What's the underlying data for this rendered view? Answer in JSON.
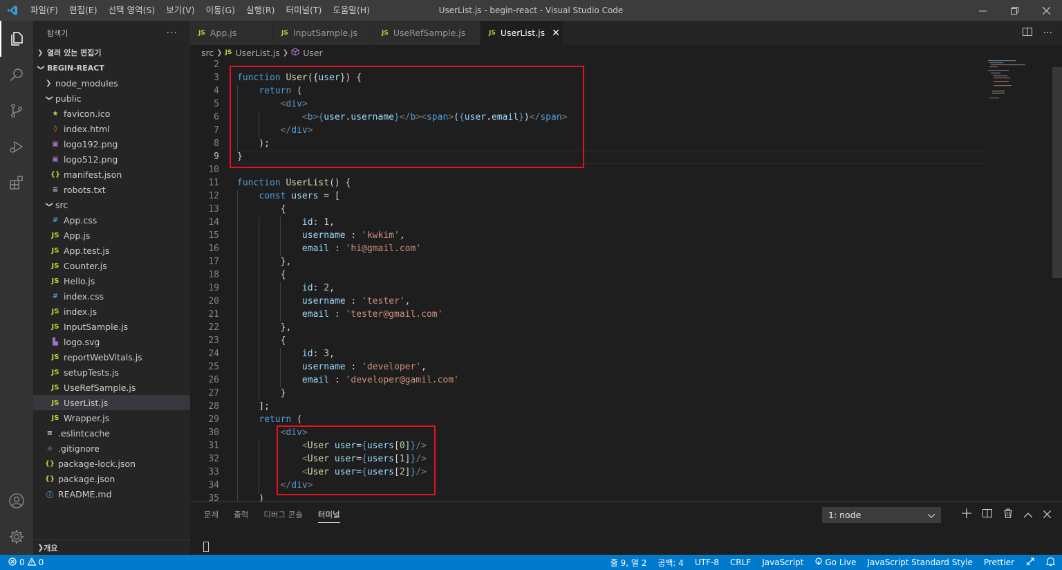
{
  "window": {
    "title": "UserList.js - begin-react - Visual Studio Code",
    "menu": [
      "파일(F)",
      "편집(E)",
      "선택 영역(S)",
      "보기(V)",
      "이동(G)",
      "실행(R)",
      "터미널(T)",
      "도움말(H)"
    ]
  },
  "sidebar": {
    "title": "탐색기",
    "open_editors": "열려 있는 편집기",
    "project": "BEGIN-REACT",
    "outline": "개요",
    "items": [
      {
        "label": "node_modules",
        "type": "folder",
        "open": false,
        "depth": 1
      },
      {
        "label": "public",
        "type": "folder",
        "open": true,
        "depth": 1
      },
      {
        "label": "favicon.ico",
        "type": "ico",
        "depth": 2
      },
      {
        "label": "index.html",
        "type": "html",
        "depth": 2
      },
      {
        "label": "logo192.png",
        "type": "img",
        "depth": 2
      },
      {
        "label": "logo512.png",
        "type": "img",
        "depth": 2
      },
      {
        "label": "manifest.json",
        "type": "json",
        "depth": 2
      },
      {
        "label": "robots.txt",
        "type": "txt",
        "depth": 2
      },
      {
        "label": "src",
        "type": "folder",
        "open": true,
        "depth": 1
      },
      {
        "label": "App.css",
        "type": "css",
        "depth": 2
      },
      {
        "label": "App.js",
        "type": "js",
        "depth": 2
      },
      {
        "label": "App.test.js",
        "type": "js",
        "depth": 2
      },
      {
        "label": "Counter.js",
        "type": "js",
        "depth": 2
      },
      {
        "label": "Hello.js",
        "type": "js",
        "depth": 2
      },
      {
        "label": "index.css",
        "type": "css",
        "depth": 2
      },
      {
        "label": "index.js",
        "type": "js",
        "depth": 2
      },
      {
        "label": "InputSample.js",
        "type": "js",
        "depth": 2
      },
      {
        "label": "logo.svg",
        "type": "svg",
        "depth": 2
      },
      {
        "label": "reportWebVitals.js",
        "type": "js",
        "depth": 2
      },
      {
        "label": "setupTests.js",
        "type": "js",
        "depth": 2
      },
      {
        "label": "UseRefSample.js",
        "type": "js",
        "depth": 2
      },
      {
        "label": "UserList.js",
        "type": "js",
        "depth": 2,
        "selected": true
      },
      {
        "label": "Wrapper.js",
        "type": "js",
        "depth": 2
      },
      {
        "label": ".eslintcache",
        "type": "txt",
        "depth": 1
      },
      {
        "label": ".gitignore",
        "type": "git",
        "depth": 1
      },
      {
        "label": "package-lock.json",
        "type": "json",
        "depth": 1
      },
      {
        "label": "package.json",
        "type": "json",
        "depth": 1
      },
      {
        "label": "README.md",
        "type": "info",
        "depth": 1
      }
    ]
  },
  "tabs": [
    {
      "label": "App.js",
      "active": false
    },
    {
      "label": "InputSample.js",
      "active": false
    },
    {
      "label": "UseRefSample.js",
      "active": false
    },
    {
      "label": "UserList.js",
      "active": true
    }
  ],
  "breadcrumb": {
    "folder": "src",
    "file": "UserList.js",
    "symbol": "User"
  },
  "editor": {
    "current_line": 9,
    "lines": [
      {
        "n": 2,
        "t": []
      },
      {
        "n": 3,
        "t": [
          [
            "kw",
            "function "
          ],
          [
            "fn",
            "User"
          ],
          [
            "plain",
            "({"
          ],
          [
            "var",
            "user"
          ],
          [
            "plain",
            "}) {"
          ]
        ]
      },
      {
        "n": 4,
        "t": [
          [
            "plain",
            "    "
          ],
          [
            "kw",
            "return"
          ],
          [
            "plain",
            " ("
          ]
        ]
      },
      {
        "n": 5,
        "t": [
          [
            "plain",
            "        "
          ],
          [
            "pun",
            "<"
          ],
          [
            "tag",
            "div"
          ],
          [
            "pun",
            ">"
          ]
        ]
      },
      {
        "n": 6,
        "t": [
          [
            "plain",
            "            "
          ],
          [
            "pun",
            "<"
          ],
          [
            "tag",
            "b"
          ],
          [
            "pun",
            ">"
          ],
          [
            "kw",
            "{"
          ],
          [
            "var",
            "user"
          ],
          [
            "plain",
            "."
          ],
          [
            "var",
            "username"
          ],
          [
            "kw",
            "}"
          ],
          [
            "pun",
            "</"
          ],
          [
            "tag",
            "b"
          ],
          [
            "pun",
            "><"
          ],
          [
            "tag",
            "span"
          ],
          [
            "pun",
            ">"
          ],
          [
            "plain",
            "("
          ],
          [
            "kw",
            "{"
          ],
          [
            "var",
            "user"
          ],
          [
            "plain",
            "."
          ],
          [
            "var",
            "email"
          ],
          [
            "kw",
            "}"
          ],
          [
            "plain",
            ")"
          ],
          [
            "pun",
            "</"
          ],
          [
            "tag",
            "span"
          ],
          [
            "pun",
            ">"
          ]
        ]
      },
      {
        "n": 7,
        "t": [
          [
            "plain",
            "        "
          ],
          [
            "pun",
            "</"
          ],
          [
            "tag",
            "div"
          ],
          [
            "pun",
            ">"
          ]
        ]
      },
      {
        "n": 8,
        "t": [
          [
            "plain",
            "    );"
          ]
        ]
      },
      {
        "n": 9,
        "t": [
          [
            "plain",
            "}"
          ]
        ]
      },
      {
        "n": 10,
        "t": []
      },
      {
        "n": 11,
        "t": [
          [
            "kw",
            "function "
          ],
          [
            "fn",
            "UserList"
          ],
          [
            "plain",
            "() {"
          ]
        ]
      },
      {
        "n": 12,
        "t": [
          [
            "plain",
            "    "
          ],
          [
            "kw",
            "const "
          ],
          [
            "var",
            "users"
          ],
          [
            "plain",
            " = ["
          ]
        ]
      },
      {
        "n": 13,
        "t": [
          [
            "plain",
            "        {"
          ]
        ]
      },
      {
        "n": 14,
        "t": [
          [
            "plain",
            "            "
          ],
          [
            "var",
            "id"
          ],
          [
            "plain",
            ": "
          ],
          [
            "num",
            "1"
          ],
          [
            "plain",
            ","
          ]
        ]
      },
      {
        "n": 15,
        "t": [
          [
            "plain",
            "            "
          ],
          [
            "var",
            "username"
          ],
          [
            "plain",
            " : "
          ],
          [
            "str",
            "'kwkim'"
          ],
          [
            "plain",
            ","
          ]
        ]
      },
      {
        "n": 16,
        "t": [
          [
            "plain",
            "            "
          ],
          [
            "var",
            "email"
          ],
          [
            "plain",
            " : "
          ],
          [
            "str",
            "'hi@gmail.com'"
          ]
        ]
      },
      {
        "n": 17,
        "t": [
          [
            "plain",
            "        },"
          ]
        ]
      },
      {
        "n": 18,
        "t": [
          [
            "plain",
            "        {"
          ]
        ]
      },
      {
        "n": 19,
        "t": [
          [
            "plain",
            "            "
          ],
          [
            "var",
            "id"
          ],
          [
            "plain",
            ": "
          ],
          [
            "num",
            "2"
          ],
          [
            "plain",
            ","
          ]
        ]
      },
      {
        "n": 20,
        "t": [
          [
            "plain",
            "            "
          ],
          [
            "var",
            "username"
          ],
          [
            "plain",
            " : "
          ],
          [
            "str",
            "'tester'"
          ],
          [
            "plain",
            ","
          ]
        ]
      },
      {
        "n": 21,
        "t": [
          [
            "plain",
            "            "
          ],
          [
            "var",
            "email"
          ],
          [
            "plain",
            " : "
          ],
          [
            "str",
            "'tester@gmail.com'"
          ]
        ]
      },
      {
        "n": 22,
        "t": [
          [
            "plain",
            "        },"
          ]
        ]
      },
      {
        "n": 23,
        "t": [
          [
            "plain",
            "        {"
          ]
        ]
      },
      {
        "n": 24,
        "t": [
          [
            "plain",
            "            "
          ],
          [
            "var",
            "id"
          ],
          [
            "plain",
            ": "
          ],
          [
            "num",
            "3"
          ],
          [
            "plain",
            ","
          ]
        ]
      },
      {
        "n": 25,
        "t": [
          [
            "plain",
            "            "
          ],
          [
            "var",
            "username"
          ],
          [
            "plain",
            " : "
          ],
          [
            "str",
            "'developer'"
          ],
          [
            "plain",
            ","
          ]
        ]
      },
      {
        "n": 26,
        "t": [
          [
            "plain",
            "            "
          ],
          [
            "var",
            "email"
          ],
          [
            "plain",
            " : "
          ],
          [
            "str",
            "'developer@gamil.com'"
          ]
        ]
      },
      {
        "n": 27,
        "t": [
          [
            "plain",
            "        }"
          ]
        ]
      },
      {
        "n": 28,
        "t": [
          [
            "plain",
            "    ];"
          ]
        ]
      },
      {
        "n": 29,
        "t": [
          [
            "plain",
            "    "
          ],
          [
            "kw",
            "return"
          ],
          [
            "plain",
            " ("
          ]
        ]
      },
      {
        "n": 30,
        "t": [
          [
            "plain",
            "        "
          ],
          [
            "pun",
            "<"
          ],
          [
            "tag",
            "div"
          ],
          [
            "pun",
            ">"
          ]
        ]
      },
      {
        "n": 31,
        "t": [
          [
            "plain",
            "            "
          ],
          [
            "pun",
            "<"
          ],
          [
            "fn",
            "User"
          ],
          [
            "plain",
            " "
          ],
          [
            "var",
            "user"
          ],
          [
            "plain",
            "="
          ],
          [
            "kw",
            "{"
          ],
          [
            "var",
            "users"
          ],
          [
            "plain",
            "["
          ],
          [
            "num",
            "0"
          ],
          [
            "plain",
            "]"
          ],
          [
            "kw",
            "}"
          ],
          [
            "pun",
            "/>"
          ]
        ]
      },
      {
        "n": 32,
        "t": [
          [
            "plain",
            "            "
          ],
          [
            "pun",
            "<"
          ],
          [
            "fn",
            "User"
          ],
          [
            "plain",
            " "
          ],
          [
            "var",
            "user"
          ],
          [
            "plain",
            "="
          ],
          [
            "kw",
            "{"
          ],
          [
            "var",
            "users"
          ],
          [
            "plain",
            "["
          ],
          [
            "num",
            "1"
          ],
          [
            "plain",
            "]"
          ],
          [
            "kw",
            "}"
          ],
          [
            "pun",
            "/>"
          ]
        ]
      },
      {
        "n": 33,
        "t": [
          [
            "plain",
            "            "
          ],
          [
            "pun",
            "<"
          ],
          [
            "fn",
            "User"
          ],
          [
            "plain",
            " "
          ],
          [
            "var",
            "user"
          ],
          [
            "plain",
            "="
          ],
          [
            "kw",
            "{"
          ],
          [
            "var",
            "users"
          ],
          [
            "plain",
            "["
          ],
          [
            "num",
            "2"
          ],
          [
            "plain",
            "]"
          ],
          [
            "kw",
            "}"
          ],
          [
            "pun",
            "/>"
          ]
        ]
      },
      {
        "n": 34,
        "t": [
          [
            "plain",
            "        "
          ],
          [
            "pun",
            "</"
          ],
          [
            "tag",
            "div"
          ],
          [
            "pun",
            ">"
          ]
        ]
      },
      {
        "n": 35,
        "t": [
          [
            "plain",
            "    )"
          ]
        ]
      }
    ]
  },
  "panel": {
    "tabs": [
      "문제",
      "출력",
      "디버그 콘솔",
      "터미널"
    ],
    "active_tab": "터미널",
    "terminal_select": "1: node"
  },
  "statusbar": {
    "errors": "0",
    "warnings": "0",
    "position": "줄 9, 열 2",
    "spaces": "공백: 4",
    "encoding": "UTF-8",
    "eol": "CRLF",
    "language": "JavaScript",
    "golive": "Go Live",
    "style": "JavaScript Standard Style",
    "prettier": "Prettier"
  },
  "colors": {
    "accent": "#007acc",
    "highlight_box": "#e81123",
    "js_icon": "#cbcb41"
  }
}
